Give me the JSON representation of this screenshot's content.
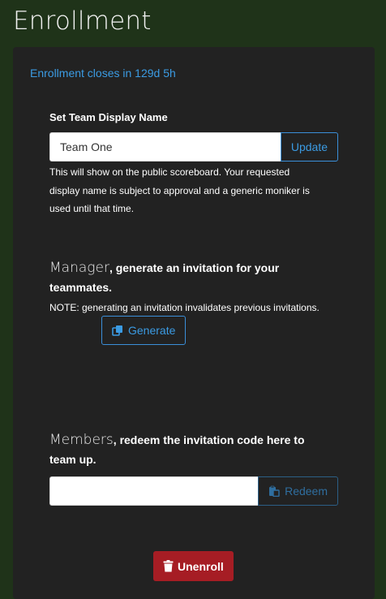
{
  "page": {
    "title": "Enrollment"
  },
  "enrollment": {
    "closes_text": "Enrollment closes in 129d 5h"
  },
  "display_name": {
    "label": "Set Team Display Name",
    "value": "Team One",
    "update_label": "Update",
    "help_text": "This will show on the public scoreboard. Your requested display name is subject to approval and a generic moniker is used until that time."
  },
  "manager": {
    "lead": "Manager",
    "rest": ", generate an invitation for your teammates.",
    "note": "NOTE: generating an invitation invalidates previous invitations.",
    "generate_label": "Generate"
  },
  "members": {
    "lead": "Members",
    "rest": ", redeem the invitation code here to team up.",
    "code_value": "",
    "redeem_label": "Redeem"
  },
  "unenroll": {
    "label": "Unenroll"
  },
  "colors": {
    "background": "#1f3319",
    "card": "#222222",
    "accent": "#3b9be3",
    "danger": "#a61d24"
  },
  "icons": {
    "generate": "copy-icon",
    "redeem": "paste-icon",
    "unenroll": "trash-icon"
  }
}
